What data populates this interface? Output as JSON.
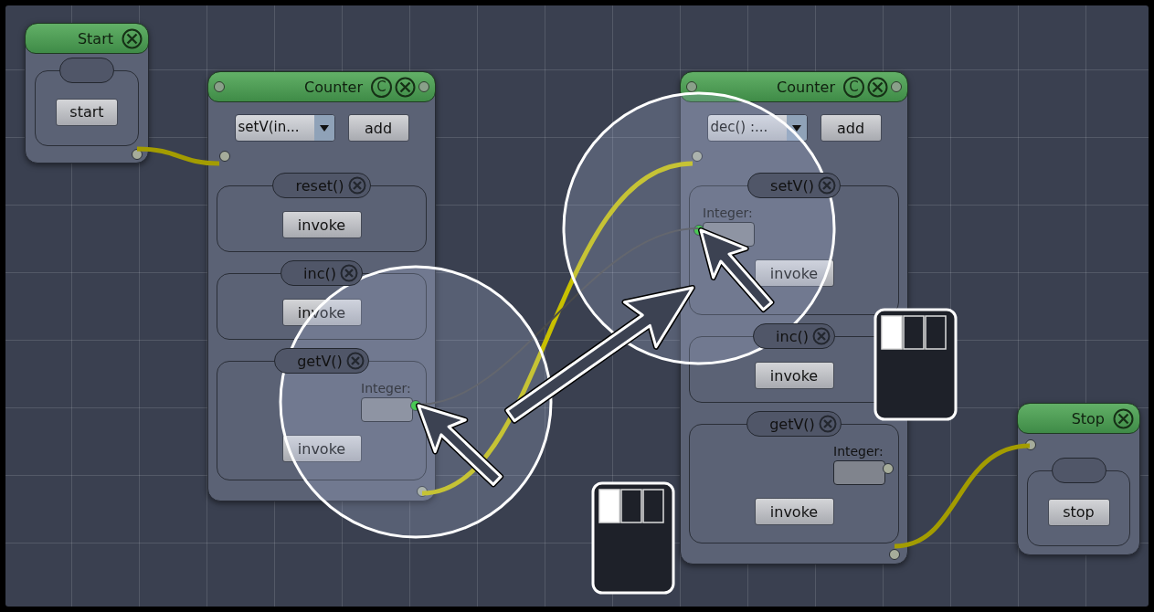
{
  "nodes": [
    {
      "kind": "start",
      "title": "Start",
      "button": "start"
    },
    {
      "kind": "class",
      "title": "Counter",
      "class_button": "C",
      "method_select": "setV(in...",
      "add_button": "add",
      "methods": [
        {
          "name": "reset()",
          "invoke": "invoke"
        },
        {
          "name": "inc()",
          "invoke": "invoke"
        },
        {
          "name": "getV()",
          "result_label": "Integer:",
          "port_highlighted": true,
          "invoke": "invoke"
        }
      ]
    },
    {
      "kind": "class",
      "title": "Counter",
      "class_button": "C",
      "method_select": "dec() :...",
      "add_button": "add",
      "methods": [
        {
          "name": "setV()",
          "param_label": "Integer:",
          "port_highlighted": true,
          "invoke": "invoke"
        },
        {
          "name": "inc()",
          "invoke": "invoke"
        },
        {
          "name": "getV()",
          "result_label": "Integer:",
          "port_highlighted": false,
          "invoke": "invoke"
        }
      ]
    },
    {
      "kind": "stop",
      "title": "Stop",
      "button": "stop"
    }
  ],
  "mouse_icons": [
    {
      "left_pressed": true
    },
    {
      "left_pressed": true
    }
  ]
}
